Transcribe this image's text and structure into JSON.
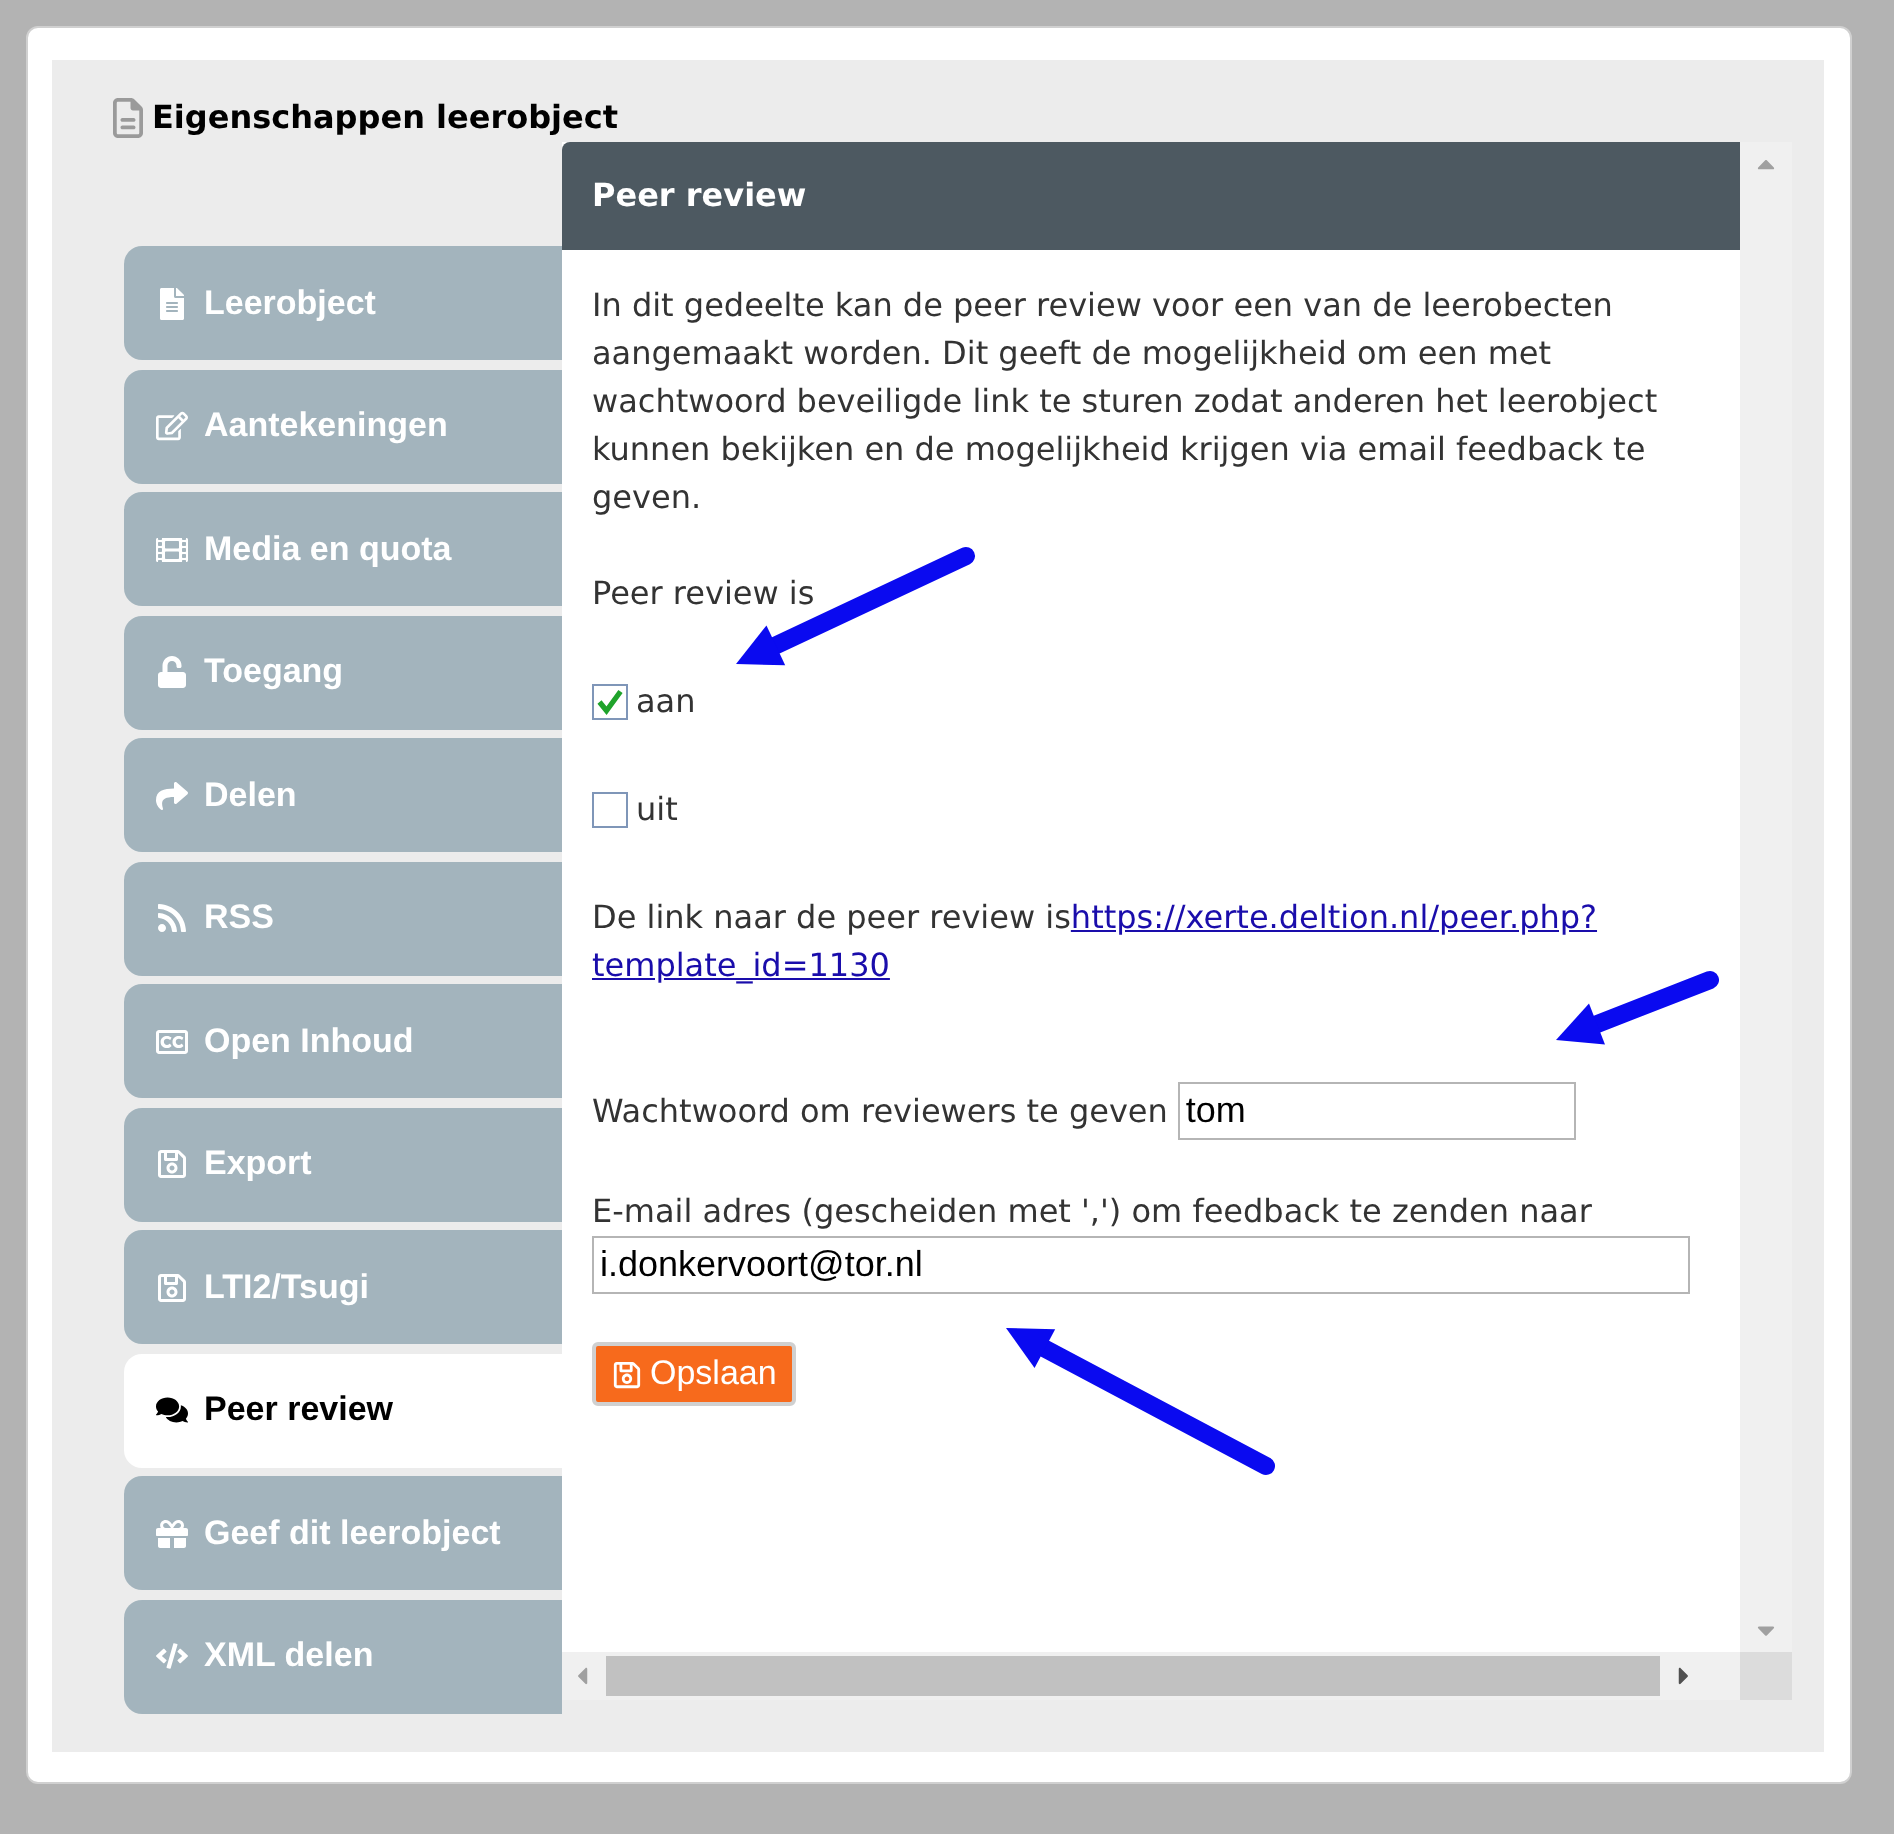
{
  "title": "Eigenschappen leerobject",
  "tabs": [
    {
      "label": "Leerobject",
      "selected": false
    },
    {
      "label": "Aantekeningen",
      "selected": false
    },
    {
      "label": "Media en quota",
      "selected": false
    },
    {
      "label": "Toegang",
      "selected": false
    },
    {
      "label": "Delen",
      "selected": false
    },
    {
      "label": "RSS",
      "selected": false
    },
    {
      "label": "Open Inhoud",
      "selected": false
    },
    {
      "label": "Export",
      "selected": false
    },
    {
      "label": "LTI2/Tsugi",
      "selected": false
    },
    {
      "label": "Peer review",
      "selected": true
    },
    {
      "label": "Geef dit leerobject",
      "selected": false
    },
    {
      "label": "XML delen",
      "selected": false
    }
  ],
  "panel": {
    "heading": "Peer review",
    "intro": "In dit gedeelte kan de peer review voor een van de leerobecten aangemaakt worden. Dit geeft de mogelijkheid om een met wachtwoord beveiligde link te sturen zodat anderen het leerobject kunnen bekijken en de mogelijkheid krijgen via email feedback te geven.",
    "status_label": "Peer review is",
    "options": [
      {
        "label": "aan",
        "checked": true
      },
      {
        "label": "uit",
        "checked": false
      }
    ],
    "link_label": "De link naar de peer review is",
    "link_lines": [
      "https://xerte.deltion.nl/peer.php?",
      "template_id=1130"
    ],
    "password_label": "Wachtwoord om reviewers te geven",
    "password_value": "tom",
    "email_label": "E-mail adres (gescheiden met ',') om feedback te zenden naar",
    "email_value": "i.donkervoort@tor.nl",
    "save_button": "Opslaan"
  }
}
